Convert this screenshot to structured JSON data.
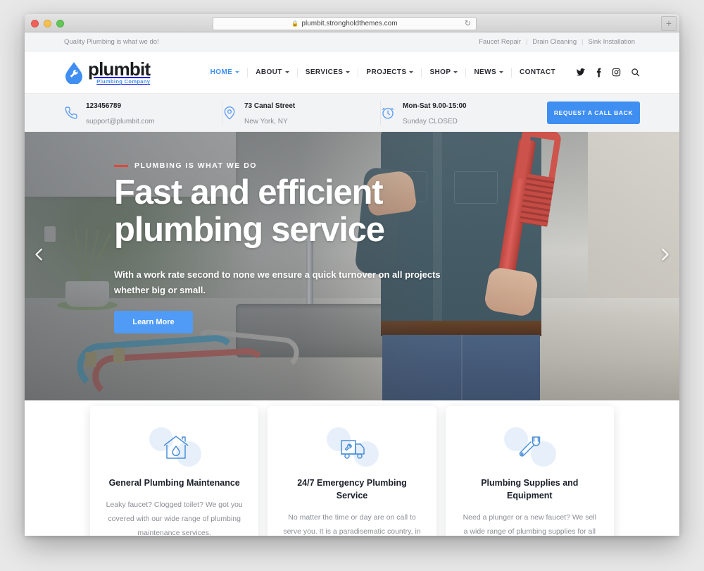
{
  "browser": {
    "url": "plumbit.strongholdthemes.com",
    "lock_icon": "lock-icon",
    "reload_icon": "reload-icon",
    "newtab_label": "+"
  },
  "topbar": {
    "tagline": "Quality Plumbing is what we do!",
    "links": [
      "Faucet Repair",
      "Drain Cleaning",
      "Sink Installation"
    ],
    "separator": "|"
  },
  "header": {
    "logo": {
      "word": "plumbit",
      "sub": "Plumbing Company",
      "mark": "water-drop-wrench-logo"
    },
    "nav": [
      {
        "label": "HOME",
        "has_caret": true,
        "active": true
      },
      {
        "label": "ABOUT",
        "has_caret": true,
        "active": false
      },
      {
        "label": "SERVICES",
        "has_caret": true,
        "active": false
      },
      {
        "label": "PROJECTS",
        "has_caret": true,
        "active": false
      },
      {
        "label": "SHOP",
        "has_caret": true,
        "active": false
      },
      {
        "label": "NEWS",
        "has_caret": true,
        "active": false
      },
      {
        "label": "CONTACT",
        "has_caret": false,
        "active": false
      }
    ],
    "social": [
      "twitter-icon",
      "facebook-icon",
      "instagram-icon",
      "search-icon"
    ]
  },
  "infobar": {
    "items": [
      {
        "icon": "phone-icon",
        "top": "123456789",
        "bottom": "support@plumbit.com"
      },
      {
        "icon": "map-pin-icon",
        "top": "73 Canal Street",
        "bottom": "New York, NY"
      },
      {
        "icon": "clock-icon",
        "top": "Mon-Sat 9.00-15:00",
        "bottom": "Sunday CLOSED"
      }
    ],
    "cta_label": "REQUEST A CALL BACK",
    "cta_color": "#3f8ef2"
  },
  "hero": {
    "eyebrow": "PLUMBING IS WHAT WE DO",
    "eyebrow_accent": "#e0473c",
    "title_line1": "Fast and efficient",
    "title_line2": "plumbing service",
    "subtitle": "With a work rate second to none we ensure a quick turnover on all projects whether big or small.",
    "button_label": "Learn More",
    "button_color": "#4f9bf6",
    "prev_icon": "chevron-left-icon",
    "next_icon": "chevron-right-icon"
  },
  "cards": [
    {
      "icon": "house-water-drop-icon",
      "title": "General Plumbing Maintenance",
      "text": "Leaky faucet? Clogged toilet? We got you covered with our wide range of plumbing maintenance services."
    },
    {
      "icon": "service-truck-icon",
      "title": "24/7 Emergency Plumbing Service",
      "text": "No matter the time or day are on call to serve you. It is a paradisematic country, in which roasted parts."
    },
    {
      "icon": "wrench-icon",
      "title": "Plumbing Supplies and Equipment",
      "text": "Need a plunger or a new faucet? We sell a wide range of plumbing supplies for all needs."
    }
  ]
}
